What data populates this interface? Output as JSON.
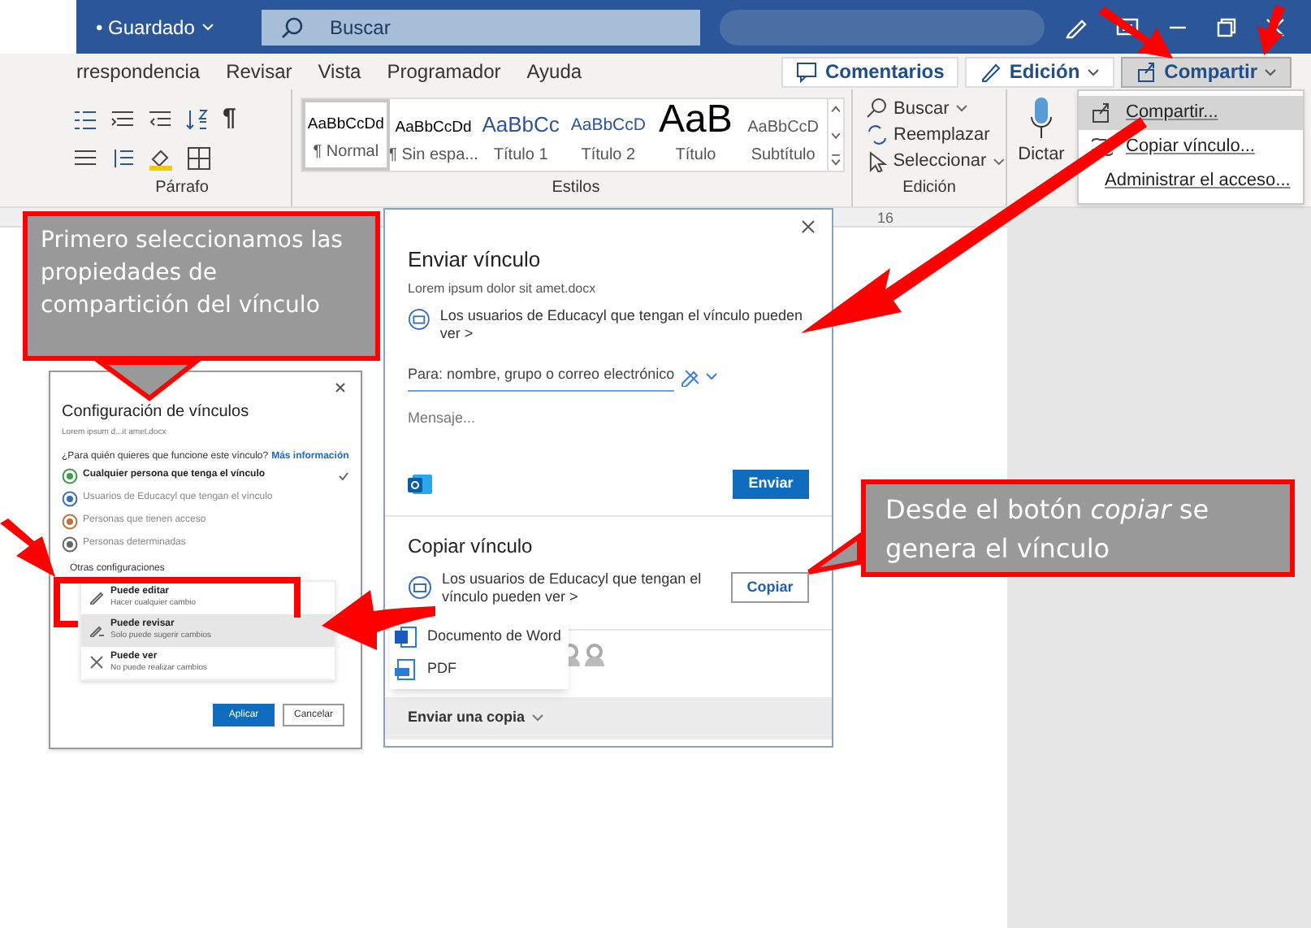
{
  "title_bar": {
    "save_status": "• Guardado",
    "search_placeholder": "Buscar"
  },
  "ribbon_tabs": [
    "rrespondencia",
    "Revisar",
    "Vista",
    "Programador",
    "Ayuda"
  ],
  "header_buttons": [
    {
      "label": "Comentarios",
      "kind": "comments"
    },
    {
      "label": "Edición",
      "kind": "mode"
    },
    {
      "label": "Compartir",
      "kind": "share"
    }
  ],
  "paragraph_group": {
    "pilcrow": "¶",
    "label": "Párrafo"
  },
  "styles_group": {
    "label": "Estilos",
    "styles": [
      {
        "preview": "AaBbCcDd",
        "name": "¶ Normal",
        "kind": "body",
        "selected": true
      },
      {
        "preview": "AaBbCcDd",
        "name": "¶ Sin espa...",
        "kind": "body",
        "selected": false
      },
      {
        "preview": "AaBbCc",
        "name": "Título 1",
        "kind": "heading1",
        "selected": false
      },
      {
        "preview": "AaBbCcD",
        "name": "Título 2",
        "kind": "heading2",
        "selected": false
      },
      {
        "preview": "AaB",
        "name": "Título",
        "kind": "title",
        "selected": false
      },
      {
        "preview": "AaBbCcD",
        "name": "Subtítulo",
        "kind": "subtitle",
        "selected": false
      }
    ]
  },
  "editing_group": {
    "label": "Edición",
    "items": [
      {
        "label": "Buscar",
        "kind": "find"
      },
      {
        "label": "Reemplazar",
        "kind": "replace"
      },
      {
        "label": "Seleccionar",
        "kind": "select"
      }
    ]
  },
  "dictate": {
    "label": "Dictar"
  },
  "ruler": {
    "mark": "16"
  },
  "share_menu": [
    {
      "label": "Compartir...",
      "kind": "share",
      "selected": true
    },
    {
      "label": "Copiar vínculo...",
      "kind": "link",
      "selected": false
    },
    {
      "label": "Administrar el acceso...",
      "kind": "manage",
      "selected": false
    }
  ],
  "link_settings": {
    "title": "Configuración de vínculos",
    "file": "Lorem ipsum d...it amet.docx",
    "question": "¿Para quién quieres que funcione este vínculo?",
    "more_link": "Más información",
    "options": [
      {
        "label": "Cualquier persona que tenga el vínculo",
        "color": "#3f9a4a",
        "selected": true
      },
      {
        "label": "Usuarios de Educacyl que tengan el vínculo",
        "color": "#3b6fb6",
        "selected": false
      },
      {
        "label": "Personas que tienen acceso",
        "color": "#c2703d",
        "selected": false
      },
      {
        "label": "Personas determinadas",
        "color": "#666666",
        "selected": false
      }
    ],
    "other_settings": "Otras configuraciones",
    "permissions": [
      {
        "title": "Puede editar",
        "detail": "Hacer cualquier cambio",
        "kind": "edit",
        "selected": false
      },
      {
        "title": "Puede revisar",
        "detail": "Solo puede sugerir cambios",
        "kind": "review",
        "selected": true
      },
      {
        "title": "Puede ver",
        "detail": "No puede realizar cambios",
        "kind": "view",
        "selected": false
      }
    ],
    "buttons": [
      {
        "label": "Aplicar",
        "primary": true
      },
      {
        "label": "Cancelar",
        "primary": false
      }
    ]
  },
  "send_link": {
    "title": "Enviar vínculo",
    "file": "Lorem ipsum dolor sit amet.docx",
    "permission": "Los usuarios de Educacyl que tengan el vínculo pueden ver",
    "permission_more": ">",
    "to_placeholder": "Para: nombre, grupo o correo electrónico",
    "message_placeholder": "Mensaje...",
    "send": "Enviar",
    "copy_title": "Copiar vínculo",
    "copy_permission": "Los usuarios de Educacyl que tengan el vínculo pueden ver >",
    "copy_button": "Copiar",
    "copy_formats": [
      {
        "label": "Documento de Word",
        "kind": "word"
      },
      {
        "label": "PDF",
        "kind": "pdf"
      }
    ],
    "send_copy": "Enviar una copia"
  },
  "callouts": [
    {
      "text": "Primero seleccionamos las propiedades de compartición del vínculo"
    },
    {
      "text": "Desde el botón *copiar* se genera el vínculo"
    }
  ]
}
